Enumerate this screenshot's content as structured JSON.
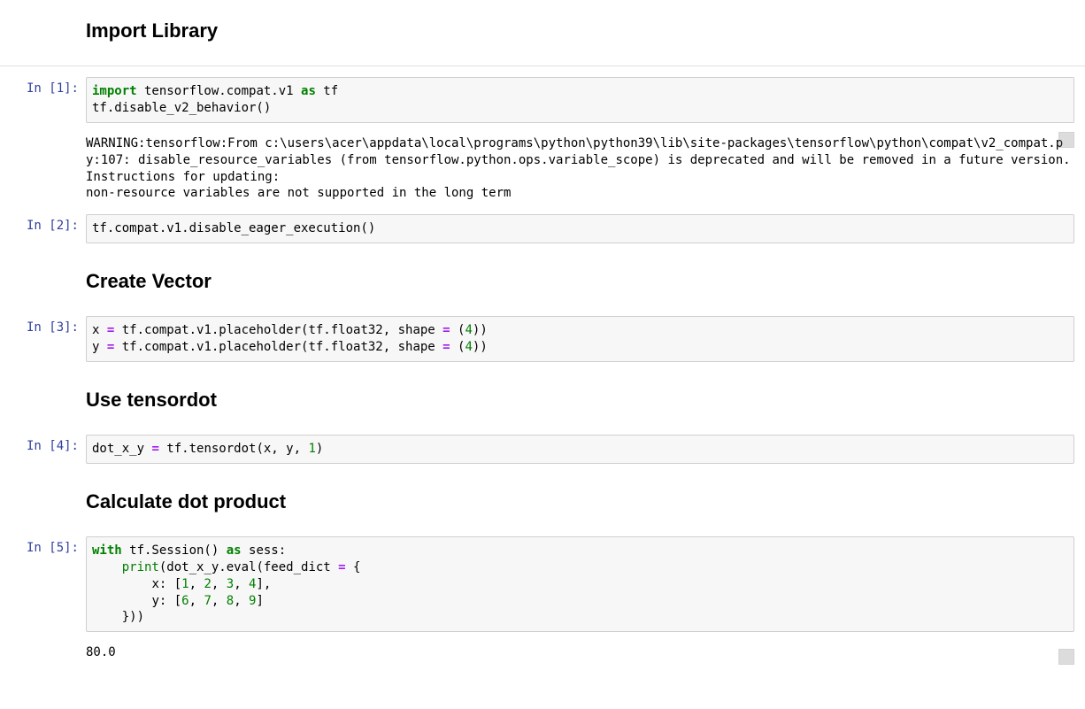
{
  "headings": {
    "h1": "Import Library",
    "h2": "Create Vector",
    "h3": "Use tensordot",
    "h4": "Calculate dot product"
  },
  "cells": {
    "c1": {
      "prompt": "In [1]:",
      "tokens": [
        {
          "t": "import",
          "c": "k"
        },
        {
          "t": " tensorflow.compat.v1 ",
          "c": "n"
        },
        {
          "t": "as",
          "c": "k"
        },
        {
          "t": " tf\n",
          "c": "n"
        },
        {
          "t": "tf.disable_v2_behavior()",
          "c": "n"
        }
      ],
      "output": "WARNING:tensorflow:From c:\\users\\acer\\appdata\\local\\programs\\python\\python39\\lib\\site-packages\\tensorflow\\python\\compat\\v2_compat.py:107: disable_resource_variables (from tensorflow.python.ops.variable_scope) is deprecated and will be removed in a future version.\nInstructions for updating:\nnon-resource variables are not supported in the long term"
    },
    "c2": {
      "prompt": "In [2]:",
      "tokens": [
        {
          "t": "tf.compat.v1.disable_eager_execution()",
          "c": "n"
        }
      ]
    },
    "c3": {
      "prompt": "In [3]:",
      "tokens": [
        {
          "t": "x ",
          "c": "n"
        },
        {
          "t": "=",
          "c": "op"
        },
        {
          "t": " tf.compat.v1.placeholder(tf.float32, shape ",
          "c": "n"
        },
        {
          "t": "=",
          "c": "op"
        },
        {
          "t": " (",
          "c": "n"
        },
        {
          "t": "4",
          "c": "mi"
        },
        {
          "t": "))\n",
          "c": "n"
        },
        {
          "t": "y ",
          "c": "n"
        },
        {
          "t": "=",
          "c": "op"
        },
        {
          "t": " tf.compat.v1.placeholder(tf.float32, shape ",
          "c": "n"
        },
        {
          "t": "=",
          "c": "op"
        },
        {
          "t": " (",
          "c": "n"
        },
        {
          "t": "4",
          "c": "mi"
        },
        {
          "t": "))",
          "c": "n"
        }
      ]
    },
    "c4": {
      "prompt": "In [4]:",
      "tokens": [
        {
          "t": "dot_x_y ",
          "c": "n"
        },
        {
          "t": "=",
          "c": "op"
        },
        {
          "t": " tf.tensordot(x, y, ",
          "c": "n"
        },
        {
          "t": "1",
          "c": "mi"
        },
        {
          "t": ")",
          "c": "n"
        }
      ]
    },
    "c5": {
      "prompt": "In [5]:",
      "tokens": [
        {
          "t": "with",
          "c": "k"
        },
        {
          "t": " tf.Session() ",
          "c": "n"
        },
        {
          "t": "as",
          "c": "k"
        },
        {
          "t": " sess:\n",
          "c": "n"
        },
        {
          "t": "    ",
          "c": "n"
        },
        {
          "t": "print",
          "c": "nb"
        },
        {
          "t": "(dot_x_y.eval(feed_dict ",
          "c": "n"
        },
        {
          "t": "=",
          "c": "op"
        },
        {
          "t": " {\n",
          "c": "n"
        },
        {
          "t": "        x: [",
          "c": "n"
        },
        {
          "t": "1",
          "c": "mi"
        },
        {
          "t": ", ",
          "c": "n"
        },
        {
          "t": "2",
          "c": "mi"
        },
        {
          "t": ", ",
          "c": "n"
        },
        {
          "t": "3",
          "c": "mi"
        },
        {
          "t": ", ",
          "c": "n"
        },
        {
          "t": "4",
          "c": "mi"
        },
        {
          "t": "],\n",
          "c": "n"
        },
        {
          "t": "        y: [",
          "c": "n"
        },
        {
          "t": "6",
          "c": "mi"
        },
        {
          "t": ", ",
          "c": "n"
        },
        {
          "t": "7",
          "c": "mi"
        },
        {
          "t": ", ",
          "c": "n"
        },
        {
          "t": "8",
          "c": "mi"
        },
        {
          "t": ", ",
          "c": "n"
        },
        {
          "t": "9",
          "c": "mi"
        },
        {
          "t": "]\n",
          "c": "n"
        },
        {
          "t": "    }))",
          "c": "n"
        }
      ],
      "output": "80.0"
    }
  }
}
